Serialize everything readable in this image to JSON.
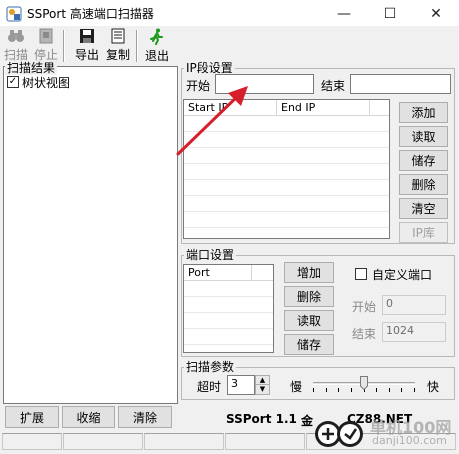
{
  "window": {
    "title": "SSPort 高速端口扫描器",
    "minimize": "—",
    "maximize": "☐",
    "close": "✕"
  },
  "toolbar": {
    "scan": "扫描",
    "stop": "停止",
    "export": "导出",
    "copy": "复制",
    "exit": "退出"
  },
  "scan_results": {
    "title": "扫描结果",
    "tree_view_checked": true,
    "tree_view_label": "树状视图",
    "expand": "扩展",
    "collapse": "收缩",
    "clear": "清除"
  },
  "ip_settings": {
    "title": "IP段设置",
    "start_label": "开始",
    "start_value": "",
    "end_label": "结束",
    "end_value": "",
    "columns": [
      "Start IP",
      "End IP"
    ],
    "buttons": {
      "add": "添加",
      "read": "读取",
      "save": "储存",
      "delete": "删除",
      "clear": "清空",
      "ip_lib": "IP库"
    }
  },
  "port_settings": {
    "title": "端口设置",
    "column": "Port",
    "buttons": {
      "add": "增加",
      "delete": "删除",
      "read": "读取",
      "save": "储存"
    },
    "custom_port_checked": false,
    "custom_port_label": "自定义端口",
    "start_label": "开始",
    "start_value": "0",
    "end_label": "结束",
    "end_value": "1024"
  },
  "scan_params": {
    "title": "扫描参数",
    "timeout_label": "超时",
    "timeout_value": "3",
    "slow_label": "慢",
    "fast_label": "快",
    "speed_fraction": 0.5
  },
  "footer": {
    "version": "SSPort 1.1",
    "credits_text": "金",
    "site": "CZ88.NET"
  },
  "watermark": {
    "text": "单机100网",
    "url": "danji100.com"
  },
  "colors": {
    "exit_icon": "#1a9a1a",
    "arrow": "#d61f2a",
    "watermark_badge": "#1e1e1e"
  }
}
